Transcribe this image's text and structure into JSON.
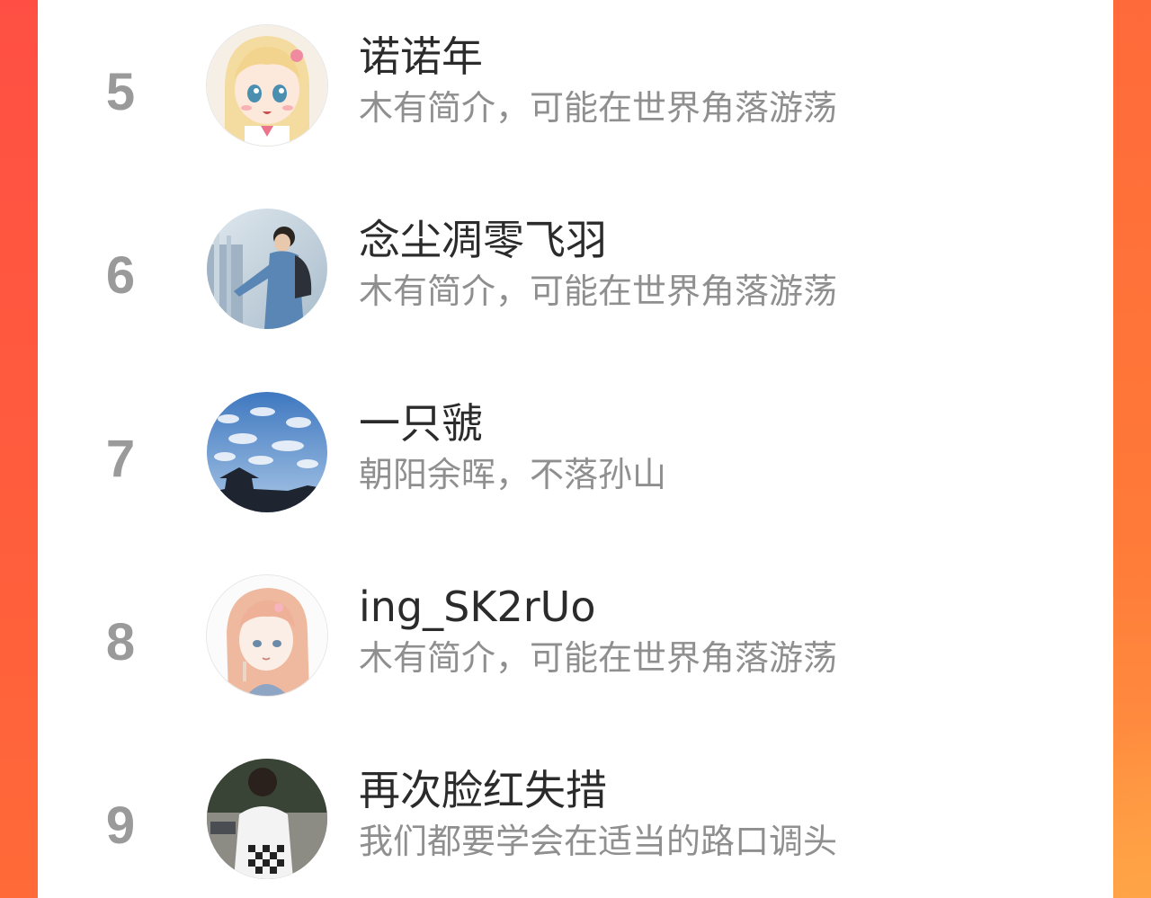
{
  "leaderboard": {
    "entries": [
      {
        "rank": "5",
        "name": "诺诺年",
        "bio": "木有简介，可能在世界角落游荡",
        "avatar": "anime-girl-avatar"
      },
      {
        "rank": "6",
        "name": "念尘凋零飞羽",
        "bio": "木有简介，可能在世界角落游荡",
        "avatar": "boy-with-backpack-avatar"
      },
      {
        "rank": "7",
        "name": "一只虢",
        "bio": "朝阳余晖，不落孙山",
        "avatar": "sky-temple-avatar"
      },
      {
        "rank": "8",
        "name": "ing_SK2rUo",
        "bio": "木有简介，可能在世界角落游荡",
        "avatar": "sketch-girl-avatar"
      },
      {
        "rank": "9",
        "name": "再次脸红失措",
        "bio": "我们都要学会在适当的路口调头",
        "avatar": "girl-back-view-avatar"
      }
    ]
  },
  "colors": {
    "background_accent": "#ff5a3c",
    "rank_text": "#9a9a9a",
    "name_text": "#2b2b2b",
    "bio_text": "#8f8f8f",
    "card": "#ffffff"
  }
}
